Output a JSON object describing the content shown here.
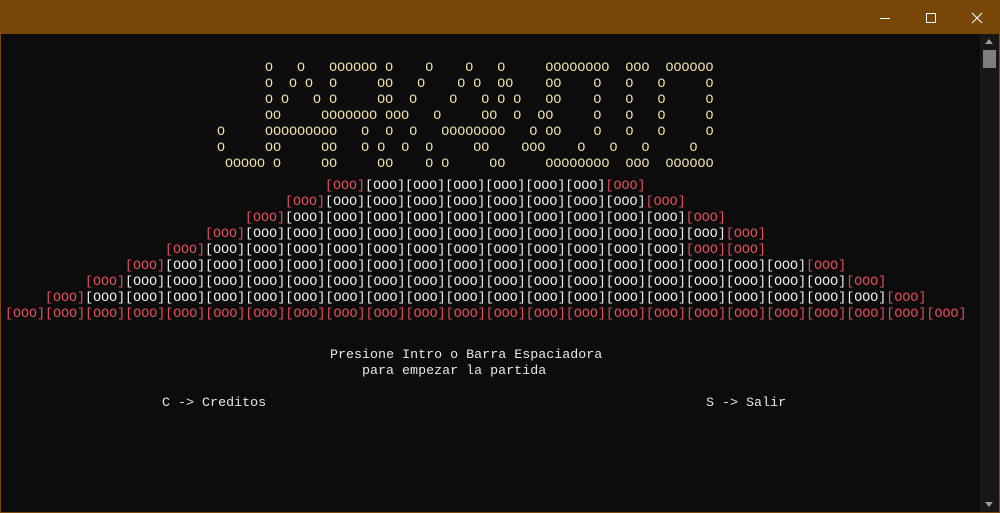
{
  "window": {
    "buttons": {
      "minimize": "minimize-icon",
      "maximize": "maximize-icon",
      "close": "close-icon"
    },
    "titlebar_color": "#784607"
  },
  "colors": {
    "logo": "#f2e2a4",
    "brick": "#f0f0f0",
    "edge_brick": "#e8505f",
    "background": "#0c0c0c"
  },
  "logo": {
    "lines": [
      "O   O   OOOOOO O    O    O   O     OOOOOOOO  OOO  OOOOOO",
      "O  O O  O     OO   O    O O  OO    OO    O   O   O     O",
      "O O   O O     OO  O    O   O O O   OO    O   O   O     O",
      "OO     OOOOOOO OOO   O     OO  O  OO     O   O   O     O",
      "O     OOOOOOOOO   O  O  O   OOOOOOOO   O OO    O   O   O     O",
      "O     OO     OO   O O  O  O     OO    OOO    O   O   O     O",
      "OOOOO O     OO     OO    O O     OO     OOOOOOOO  OOO  OOOOOO"
    ],
    "offsets": [
      33,
      33,
      33,
      33,
      27,
      27,
      28
    ]
  },
  "pyramid": {
    "brick": "[OOO]",
    "rows": [
      {
        "start": 8,
        "count": 8,
        "red": [
          0,
          7
        ]
      },
      {
        "start": 7,
        "count": 10,
        "red": [
          0,
          9
        ]
      },
      {
        "start": 6,
        "count": 12,
        "red": [
          0,
          11
        ]
      },
      {
        "start": 5,
        "count": 14,
        "red": [
          0,
          13
        ]
      },
      {
        "start": 4,
        "count": 15,
        "red": [
          0,
          13,
          14
        ]
      },
      {
        "start": 3,
        "count": 18,
        "red": [
          0,
          17
        ]
      },
      {
        "start": 2,
        "count": 20,
        "red": [
          0,
          19
        ]
      },
      {
        "start": 1,
        "count": 22,
        "red": [
          0,
          21
        ]
      },
      {
        "start": 0,
        "count": 24,
        "all_red": true
      }
    ]
  },
  "messages": {
    "prompt_line1": "Presione Intro o Barra Espaciadora",
    "prompt_line2": "para empezar la partida",
    "credits": "C -> Creditos",
    "exit": "S -> Salir"
  }
}
